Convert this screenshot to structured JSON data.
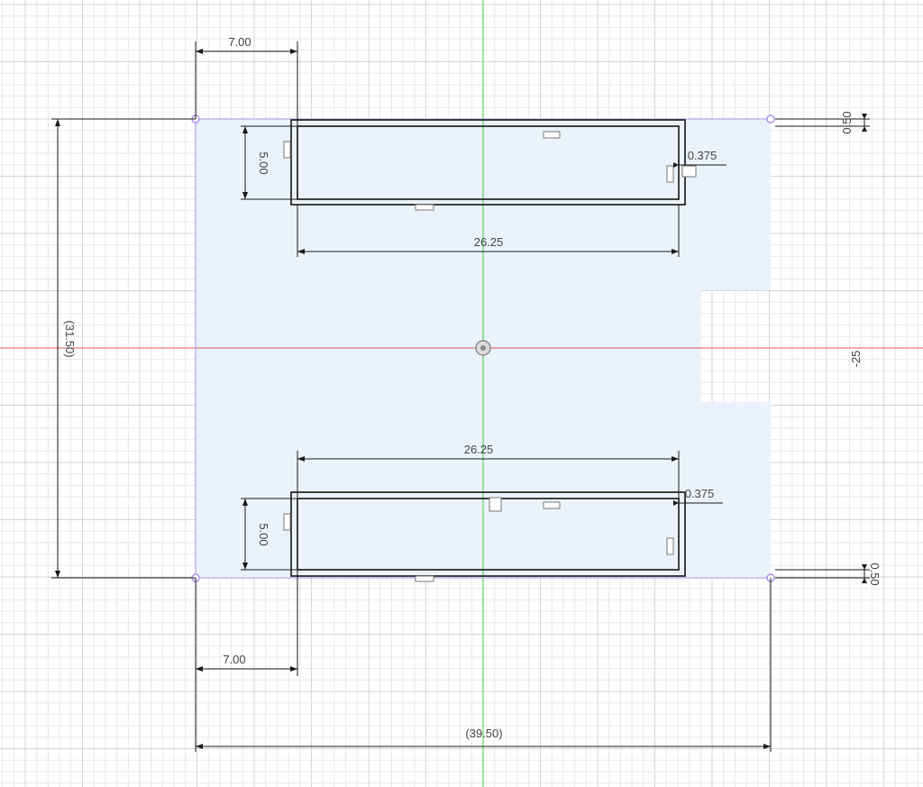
{
  "colors": {
    "background": "#ffffff",
    "grid_minor": "#e8e8e8",
    "grid_major": "#d4d4d4",
    "axis_x": "#e05a5a",
    "axis_y": "#3fca3f",
    "profile_fill": "#eaf3fb",
    "construction": "#b8a8ee",
    "slot_stroke": "#2b2b2b",
    "dimension": "#1a1a1a",
    "dim_text": "#444444"
  },
  "dimensions": {
    "top_left_offset": "7.00",
    "top_slot_height": "5.00",
    "top_slot_length": "26.25",
    "top_wall": "0.375",
    "top_right_gap": "0.50",
    "overall_height": "(31.50)",
    "axis_label": "-25",
    "bottom_slot_length": "26.25",
    "bottom_wall": "0.375",
    "bottom_slot_height": "5.00",
    "bottom_right_gap": "0.50",
    "bottom_left_offset": "7.00",
    "overall_width": "(39.50)"
  },
  "icons": {
    "origin": "origin-icon",
    "constraints": "constraint-icon"
  }
}
